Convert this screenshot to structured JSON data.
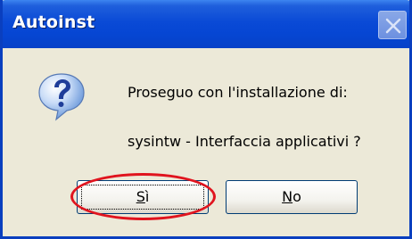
{
  "dialog": {
    "title": "Autoinst",
    "message_line1": "Proseguo con l'installazione di:",
    "message_line2": "sysintw - Interfaccia applicativi ?",
    "icon": "question-icon",
    "buttons": {
      "yes": {
        "prefix": "",
        "mnemonic": "S",
        "suffix": "ì"
      },
      "no": {
        "prefix": "",
        "mnemonic": "N",
        "suffix": "o"
      }
    },
    "highlight_color": "#e0141e",
    "titlebar_color": "#0a4ad6"
  }
}
